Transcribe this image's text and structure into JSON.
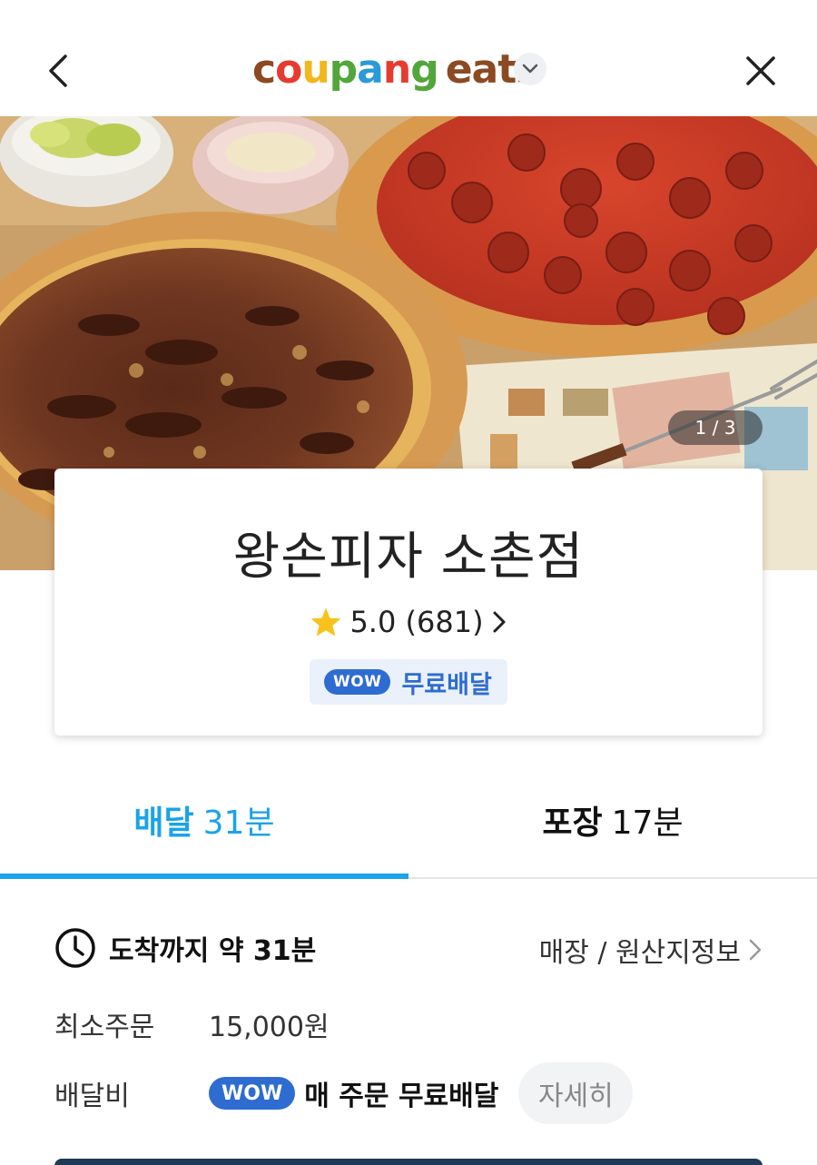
{
  "header": {
    "back_icon": "chevron-left-icon",
    "close_icon": "close-icon",
    "logo": {
      "coupang": "coupang",
      "eats": "eats"
    },
    "dropdown_icon": "chevron-down-icon"
  },
  "hero": {
    "counter": "1 / 3"
  },
  "store": {
    "name": "왕손피자 소촌점",
    "rating": "5.0 (681)",
    "wow_badge": "WOW",
    "free_delivery": "무료배달"
  },
  "tabs": [
    {
      "label": "배달",
      "time": "31분",
      "active": true
    },
    {
      "label": "포장",
      "time": "17분",
      "active": false
    }
  ],
  "info": {
    "eta": "도착까지 약 31분",
    "store_info_link": "매장 / 원산지정보",
    "min_order_label": "최소주문",
    "min_order_value": "15,000원",
    "delivery_fee_label": "배달비",
    "delivery_fee_badge": "WOW",
    "delivery_fee_value": "매 주문 무료배달",
    "detail_button": "자세히"
  },
  "colors": {
    "accent_blue": "#1aa3e8",
    "wow_blue": "#2e6cd1",
    "star": "#f7c21b"
  }
}
